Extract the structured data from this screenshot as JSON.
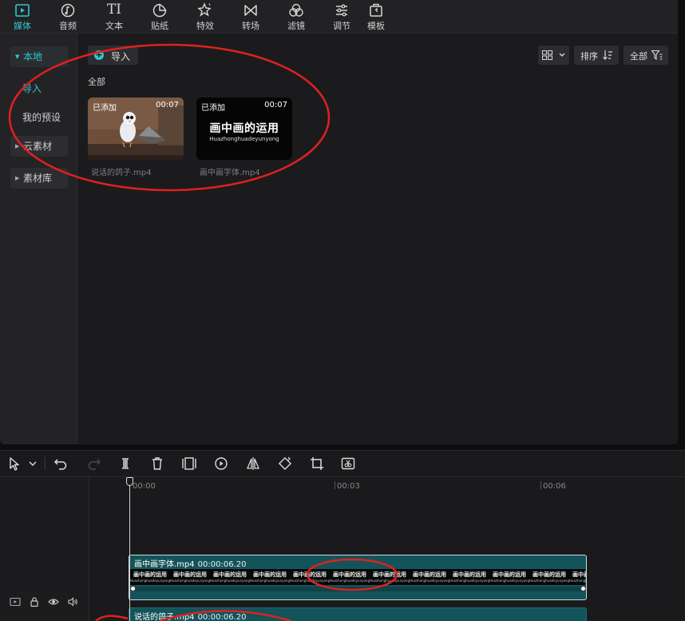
{
  "toolbar": {
    "tabs": [
      {
        "label": "媒体",
        "icon": "media-icon",
        "active": true
      },
      {
        "label": "音频",
        "icon": "audio-icon"
      },
      {
        "label": "文本",
        "icon": "text-icon"
      },
      {
        "label": "贴纸",
        "icon": "sticker-icon"
      },
      {
        "label": "特效",
        "icon": "effects-icon"
      },
      {
        "label": "转场",
        "icon": "transition-icon"
      },
      {
        "label": "滤镜",
        "icon": "filter-icon"
      },
      {
        "label": "调节",
        "icon": "adjust-icon"
      },
      {
        "label": "模板",
        "icon": "template-icon"
      }
    ],
    "text_icon_glyph": "TI"
  },
  "sidebar": {
    "local": "本地",
    "import": "导入",
    "presets": "我的预设",
    "cloud": "云素材",
    "library": "素材库"
  },
  "media": {
    "import_label": "导入",
    "sort_label": "排序",
    "filter_label": "全部",
    "section_label": "全部",
    "items": [
      {
        "tag": "已添加",
        "duration": "00:07",
        "filename": "说话的鸽子.mp4"
      },
      {
        "tag": "已添加",
        "duration": "00:07",
        "filename": "画中画字体.mp4",
        "title_art": "画中画的运用",
        "subtitle_art": "Huazhonghuadeyunyong"
      }
    ]
  },
  "timeline": {
    "ticks": [
      "00:00",
      "00:03",
      "00:06"
    ],
    "clips": [
      {
        "name": "画中画字体.mp4",
        "duration": "00:00:06.20",
        "frame_title": "画中画的运用",
        "frame_sub": "Huazhonghuadeyunyong"
      },
      {
        "name": "说话的鸽子.mp4",
        "duration": "00:00:06.20"
      }
    ]
  },
  "colors": {
    "accent": "#2fc7d3",
    "clip": "#13535a",
    "annotation": "#e02020"
  }
}
